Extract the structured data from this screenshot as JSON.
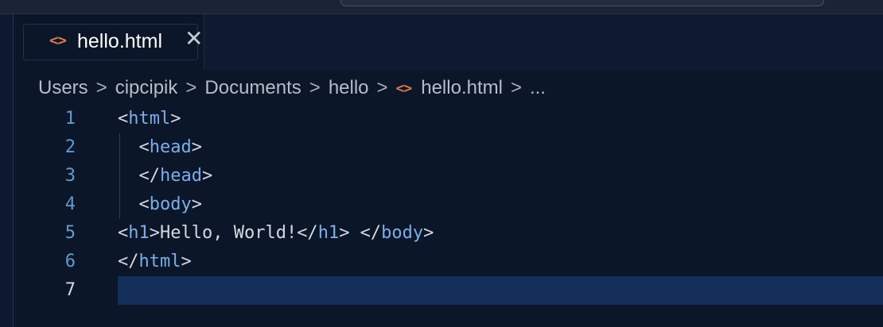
{
  "tab": {
    "icon": "code-brackets-icon",
    "icon_glyph": "<>",
    "label": "hello.html",
    "close_glyph": "✕"
  },
  "breadcrumb": {
    "items": [
      "Users",
      "cipcipik",
      "Documents",
      "hello",
      "hello.html",
      "..."
    ],
    "separator": ">",
    "file_icon_glyph": "<>"
  },
  "editor": {
    "line_numbers": [
      "1",
      "2",
      "3",
      "4",
      "5",
      "6",
      "7"
    ],
    "active_line": "7",
    "lines": [
      [
        {
          "t": "<",
          "c": "punct"
        },
        {
          "t": "html",
          "c": "tag"
        },
        {
          "t": ">",
          "c": "punct"
        }
      ],
      [
        {
          "t": "  <",
          "c": "punct"
        },
        {
          "t": "head",
          "c": "tag"
        },
        {
          "t": ">",
          "c": "punct"
        }
      ],
      [
        {
          "t": "  </",
          "c": "punct"
        },
        {
          "t": "head",
          "c": "tag"
        },
        {
          "t": ">",
          "c": "punct"
        }
      ],
      [
        {
          "t": "  <",
          "c": "punct"
        },
        {
          "t": "body",
          "c": "tag"
        },
        {
          "t": ">",
          "c": "punct"
        }
      ],
      [
        {
          "t": "<",
          "c": "punct"
        },
        {
          "t": "h1",
          "c": "tag"
        },
        {
          "t": ">",
          "c": "punct"
        },
        {
          "t": "Hello, World!",
          "c": "txt"
        },
        {
          "t": "</",
          "c": "punct"
        },
        {
          "t": "h1",
          "c": "tag"
        },
        {
          "t": "> </",
          "c": "punct"
        },
        {
          "t": "body",
          "c": "tag"
        },
        {
          "t": ">",
          "c": "punct"
        }
      ],
      [
        {
          "t": "</",
          "c": "punct"
        },
        {
          "t": "html",
          "c": "tag"
        },
        {
          "t": ">",
          "c": "punct"
        }
      ],
      []
    ]
  },
  "colors": {
    "background": "#0b1628",
    "tag": "#7aaee8",
    "file_icon": "#e0794a",
    "line_number": "#5e9bd0",
    "current_line_highlight": "#14305a"
  }
}
